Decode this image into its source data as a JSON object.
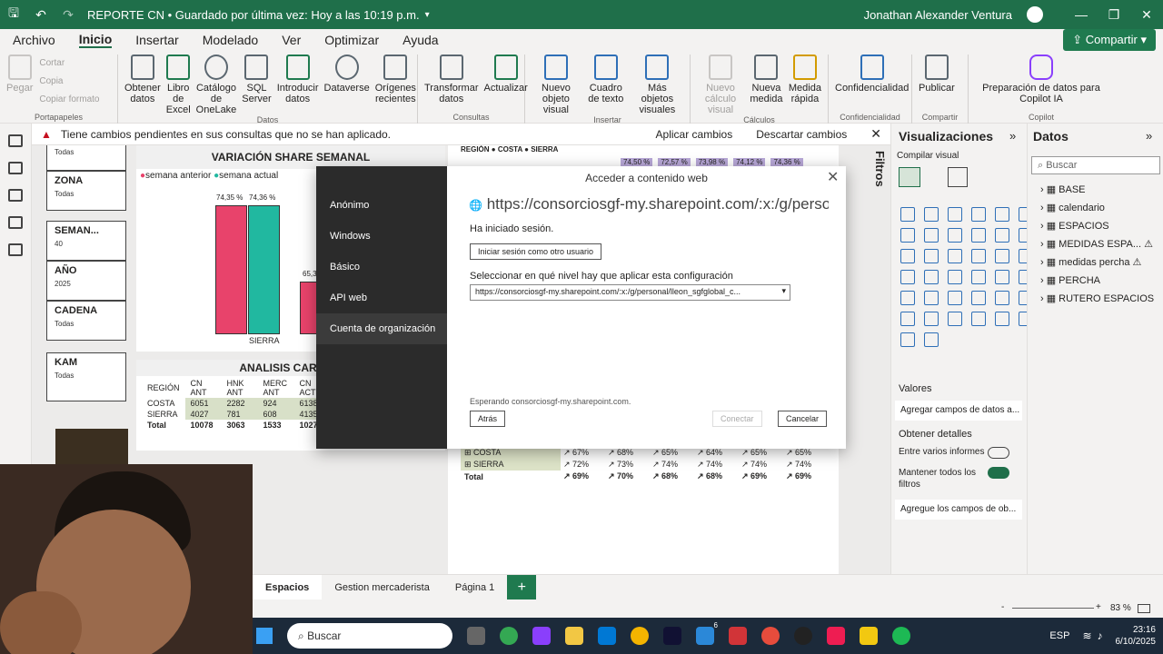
{
  "titlebar": {
    "title": "REPORTE CN • Guardado por última vez: Hoy a las 10:19 p.m.",
    "user": "Jonathan Alexander Ventura"
  },
  "menu": {
    "items": [
      "Archivo",
      "Inicio",
      "Insertar",
      "Modelado",
      "Ver",
      "Optimizar",
      "Ayuda"
    ],
    "share": "Compartir"
  },
  "ribbon": {
    "clipboard": {
      "pegar": "Pegar",
      "cortar": "Cortar",
      "copia": "Copia",
      "copiar_formato": "Copiar formato",
      "label": "Portapapeles"
    },
    "datos": {
      "b1": "Obtener datos",
      "b2": "Libro de Excel",
      "b3": "Catálogo de OneLake",
      "b4": "SQL Server",
      "b5": "Introducir datos",
      "b6": "Dataverse",
      "b7": "Orígenes recientes",
      "label": "Datos"
    },
    "consultas": {
      "b1": "Transformar datos",
      "b2": "Actualizar",
      "label": "Consultas"
    },
    "insertar": {
      "b1": "Nuevo objeto visual",
      "b2": "Cuadro de texto",
      "b3": "Más objetos visuales",
      "label": "Insertar"
    },
    "calculos": {
      "b1": "Nuevo cálculo visual",
      "b2": "Nueva medida",
      "b3": "Medida rápida",
      "label": "Cálculos"
    },
    "conf": {
      "b1": "Confidencialidad",
      "label": "Confidencialidad"
    },
    "compartir": {
      "b1": "Publicar",
      "label": "Compartir"
    },
    "copilot": {
      "b1": "Preparación de datos para Copilot IA",
      "label": "Copilot"
    }
  },
  "notification": {
    "text": "Tiene cambios pendientes en sus consultas que no se han aplicado.",
    "apply": "Aplicar cambios",
    "discard": "Descartar cambios"
  },
  "slicers": [
    {
      "title": "",
      "value": "Todas"
    },
    {
      "title": "ZONA",
      "value": "Todas"
    },
    {
      "title": "SEMAN...",
      "value": "40"
    },
    {
      "title": "AÑO",
      "value": "2025"
    },
    {
      "title": "CADENA",
      "value": "Todas"
    },
    {
      "title": "KAM",
      "value": "Todas"
    }
  ],
  "chart_data": {
    "type": "bar",
    "title": "VARIACIÓN SHARE SEMANAL",
    "series": [
      {
        "name": "semana anterior",
        "values": [
          74.35
        ]
      },
      {
        "name": "semana actual",
        "values": [
          74.36
        ]
      }
    ],
    "categories": [
      "SIERRA"
    ],
    "labels": [
      "74,35 %",
      "74,36 %"
    ],
    "partial_label": "65,3",
    "colors": {
      "anterior": "#e8436b",
      "actual": "#21b8a0"
    }
  },
  "caras_table": {
    "title": "ANALISIS CARAS S",
    "headers": [
      "REGIÓN",
      "CN ANT",
      "HNK ANT",
      "MERC ANT",
      "CN ACT"
    ],
    "rows": [
      [
        "COSTA",
        "6051",
        "2282",
        "924",
        "6138"
      ],
      [
        "SIERRA",
        "4027",
        "781",
        "608",
        "4135"
      ],
      [
        "Total",
        "10078",
        "3063",
        "1533",
        "10273"
      ]
    ]
  },
  "right_visual": {
    "legend": "REGIÓN ● COSTA ● SIERRA",
    "top_labels": [
      "74,50 %",
      "72,57 %",
      "73,98 %",
      "74,12 %",
      "74,36 %"
    ],
    "rows": [
      {
        "name": "COSTA",
        "vals": [
          "↗ 67%",
          "↗ 68%",
          "↗ 65%",
          "↗ 64%",
          "↗ 65%",
          "↗ 65%"
        ]
      },
      {
        "name": "SIERRA",
        "vals": [
          "↗ 72%",
          "↗ 73%",
          "↗ 74%",
          "↗ 74%",
          "↗ 74%",
          "↗ 74%"
        ]
      },
      {
        "name": "Total",
        "vals": [
          "↗ 69%",
          "↗ 70%",
          "↗ 68%",
          "↗ 68%",
          "↗ 69%",
          "↗ 69%"
        ]
      }
    ]
  },
  "dialog": {
    "title": "Acceder a contenido web",
    "nav": [
      "Anónimo",
      "Windows",
      "Básico",
      "API web",
      "Cuenta de organización"
    ],
    "url": "https://consorciosgf-my.sharepoint.com/:x:/g/perso...",
    "signed": "Ha iniciado sesión.",
    "signin_other": "Iniciar sesión como otro usuario",
    "level_label": "Seleccionar en qué nivel hay que aplicar esta configuración",
    "level_value": "https://consorciosgf-my.sharepoint.com/:x:/g/personal/lleon_sgfglobal_c...",
    "waiting": "Esperando consorciosgf-my.sharepoint.com.",
    "back": "Atrás",
    "connect": "Conectar",
    "cancel": "Cancelar"
  },
  "filters_label": "Filtros",
  "visualizations": {
    "title": "Visualizaciones",
    "build": "Compilar visual",
    "values": "Valores",
    "add_fields": "Agregar campos de datos a...",
    "obtain": "Obtener detalles",
    "cross": "Entre varios informes",
    "keep": "Mantener todos los filtros",
    "add_ob": "Agregue los campos de ob..."
  },
  "data_pane": {
    "title": "Datos",
    "search": "Buscar",
    "items": [
      "BASE",
      "calendario",
      "ESPACIOS",
      "MEDIDAS ESPA...",
      "medidas percha",
      "PERCHA",
      "RUTERO ESPACIOS"
    ]
  },
  "pages": [
    "Espacios",
    "Gestion mercaderista",
    "Página 1"
  ],
  "zoom": "83 %",
  "taskbar": {
    "search": "Buscar",
    "lang": "ESP",
    "time": "23:16",
    "date": "6/10/2025",
    "badge": "6"
  }
}
